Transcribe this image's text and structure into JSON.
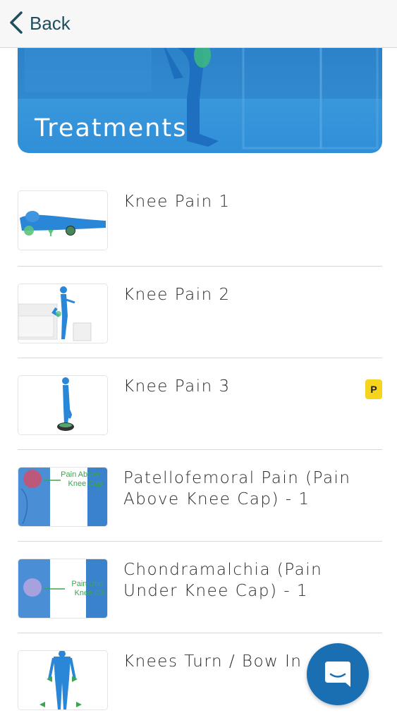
{
  "nav": {
    "back_label": "Back"
  },
  "hero": {
    "title": "Treatments"
  },
  "treatments": [
    {
      "title": "Knee Pain 1",
      "premium": false
    },
    {
      "title": "Knee Pain 2",
      "premium": false
    },
    {
      "title": "Knee Pain 3",
      "premium": true,
      "badge": "P"
    },
    {
      "title": "Patellofemoral Pain (Pain Above Knee Cap) - 1",
      "premium": false,
      "thumb_label": "Pain Above Knee Cap"
    },
    {
      "title": "Chondramalchia (Pain Under Knee Cap) - 1",
      "premium": false,
      "thumb_label": "Pain Under Knee Cap"
    },
    {
      "title": "Knees Turn / Bow In -",
      "premium": false
    }
  ],
  "colors": {
    "accent_blue": "#2f8fd8",
    "badge_yellow": "#f6d31c",
    "nav_text": "#1f4f5e",
    "chat_fab": "#1a6fb3"
  },
  "icons": {
    "back": "chevron-left-icon",
    "chat": "chat-bubble-icon"
  }
}
